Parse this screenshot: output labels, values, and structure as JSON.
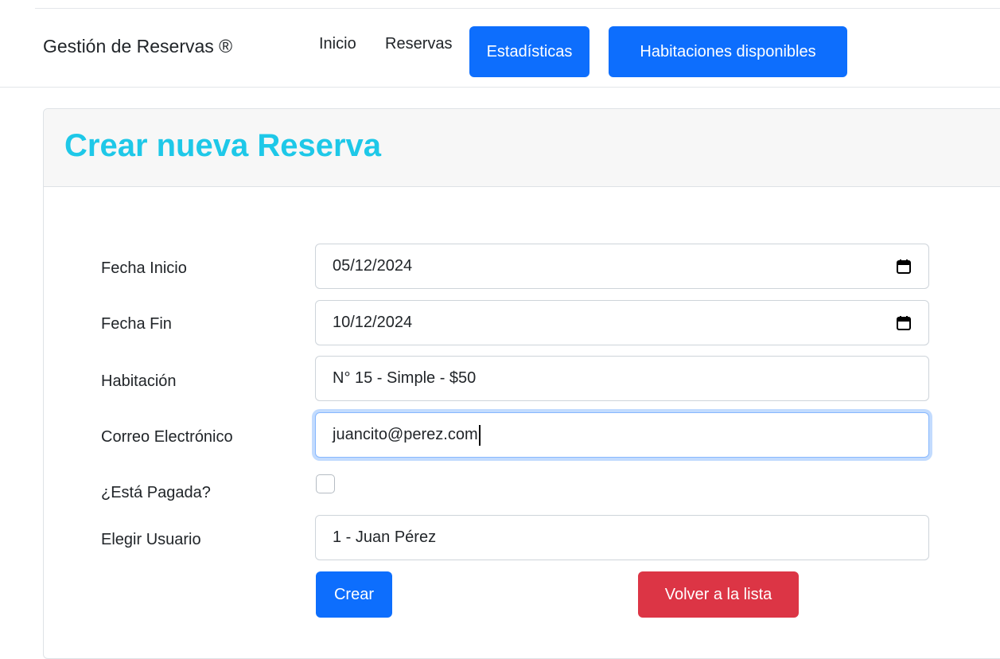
{
  "navbar": {
    "brand": "Gestión de Reservas ®",
    "links": {
      "inicio": "Inicio",
      "reservas": "Reservas"
    },
    "buttons": {
      "estadisticas": "Estadísticas",
      "habitaciones": "Habitaciones disponibles"
    }
  },
  "page": {
    "title": "Crear nueva Reserva"
  },
  "form": {
    "fecha_inicio": {
      "label": "Fecha Inicio",
      "value": "05/12/2024",
      "icon": "calendar-icon"
    },
    "fecha_fin": {
      "label": "Fecha Fin",
      "value": "10/12/2024",
      "icon": "calendar-icon"
    },
    "habitacion": {
      "label": "Habitación",
      "value": "N° 15 - Simple - $50"
    },
    "correo": {
      "label": "Correo Electrónico",
      "value": "juancito@perez.com"
    },
    "pagada": {
      "label": "¿Está Pagada?",
      "checked": false
    },
    "usuario": {
      "label": "Elegir Usuario",
      "value": "1 - Juan Pérez"
    }
  },
  "actions": {
    "crear": "Crear",
    "volver": "Volver a la lista"
  },
  "colors": {
    "primary": "#0d6efd",
    "danger": "#dc3545",
    "title": "#1ec8e8",
    "focus_border": "#86b7fe"
  }
}
